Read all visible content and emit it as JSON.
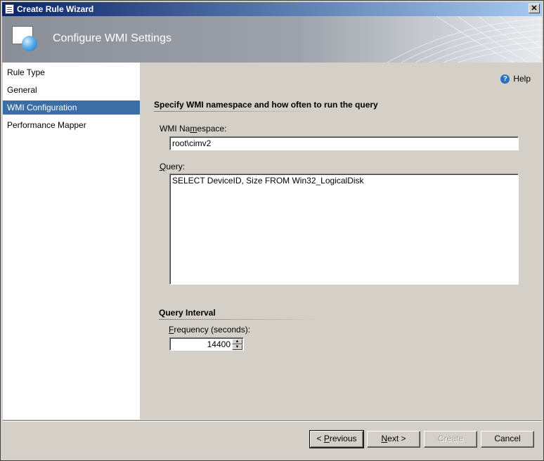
{
  "window": {
    "title": "Create Rule Wizard",
    "close_glyph": "✕"
  },
  "header": {
    "title": "Configure WMI Settings"
  },
  "sidebar": {
    "items": [
      {
        "label": "Rule Type",
        "selected": false
      },
      {
        "label": "General",
        "selected": false
      },
      {
        "label": "WMI Configuration",
        "selected": true
      },
      {
        "label": "Performance Mapper",
        "selected": false
      }
    ]
  },
  "main": {
    "help_label": "Help",
    "section_title": "Specify WMI namespace and how often to run the query",
    "namespace": {
      "label_prefix": "WMI Na",
      "label_accel": "m",
      "label_suffix": "espace:",
      "value": "root\\cimv2"
    },
    "query": {
      "label_accel": "Q",
      "label_suffix": "uery:",
      "value": "SELECT DeviceID, Size FROM Win32_LogicalDisk"
    },
    "interval": {
      "title": "Query Interval",
      "frequency_label_accel": "F",
      "frequency_label_suffix": "requency (seconds):",
      "frequency_value": "14400"
    }
  },
  "buttons": {
    "previous": {
      "accel": "P",
      "label_prefix": "< ",
      "label_suffix": "revious"
    },
    "next": {
      "accel": "N",
      "label_suffix": "ext >"
    },
    "create": "Create",
    "cancel": "Cancel"
  },
  "colors": {
    "selection": "#3a6ea5",
    "dialog_bg": "#d4d0c8",
    "title_bar_start": "#0a246a"
  }
}
